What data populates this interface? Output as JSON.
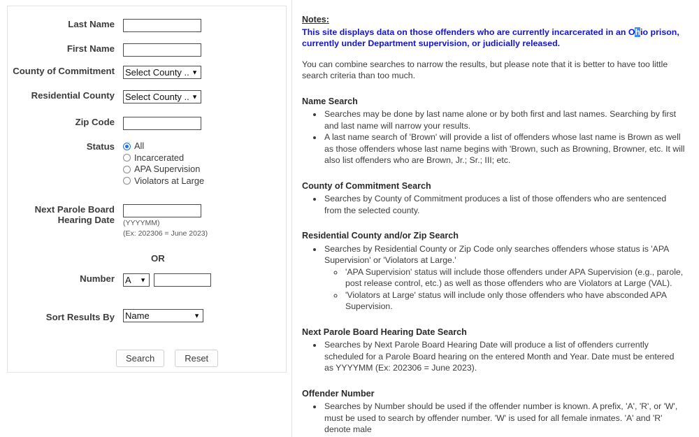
{
  "form": {
    "fields": {
      "last_name_label": "Last Name",
      "last_name_value": "",
      "first_name_label": "First Name",
      "first_name_value": "",
      "county_commitment_label": "County of Commitment",
      "county_commitment_value": "Select County ...",
      "residential_county_label": "Residential County",
      "residential_county_value": "Select County ...",
      "zip_label": "Zip Code",
      "zip_value": "",
      "status_label": "Status",
      "parole_date_label_line1": "Next Parole Board",
      "parole_date_label_line2": "Hearing Date",
      "parole_date_value": "",
      "parole_hint_format": "(YYYYMM)",
      "parole_hint_example": "(Ex: 202306 = June 2023)",
      "or_text": "OR",
      "number_label": "Number",
      "number_prefix_value": "A",
      "number_value": "",
      "sort_label": "Sort Results By",
      "sort_value": "Name"
    },
    "status_options": [
      {
        "label": "All",
        "selected": true
      },
      {
        "label": "Incarcerated",
        "selected": false
      },
      {
        "label": "APA Supervision",
        "selected": false
      },
      {
        "label": "Violators at Large",
        "selected": false
      }
    ],
    "buttons": {
      "search": "Search",
      "reset": "Reset"
    }
  },
  "notes": {
    "title": "Notes:",
    "highlight_line_a": "This site displays data on those offenders who are currently incarcerated in an O",
    "highlight_selected_char": "h",
    "highlight_line_b": "io prison, currently under Department supervision, or judicially released.",
    "intro_paragraph": "You can combine searches to narrow the results, but please note that it is better to have too little search criteria than too much.",
    "selection_color": "#3a8ef6",
    "blue_text_color": "#1414d2",
    "sections": [
      {
        "heading": "Name Search",
        "bullets": [
          "Searches may be done by last name alone or by both first and last names. Searching by first and last name will narrow your results.",
          "A last name search of 'Brown' will provide a list of offenders whose last name is Brown as well as those offenders whose last name begins with 'Brown, such as Browning, Browner, etc. It will also list offenders who are Brown, Jr.; Sr.; III; etc."
        ]
      },
      {
        "heading": "County of Commitment Search",
        "bullets": [
          "Searches by County of Commitment produces a list of those offenders who are sentenced from the selected county."
        ]
      },
      {
        "heading": "Residential County and/or Zip Search",
        "bullets": [
          "Searches by Residential County or Zip Code only searches offenders whose status is 'APA Supervision' or 'Violators at Large.'"
        ],
        "subbullets": [
          "'APA Supervision' status will include those offenders under APA Supervision (e.g., parole, post release control, etc.) as well as those offenders who are Violators at Large (VAL).",
          "'Violators at Large' status will include only those offenders who have absconded APA Supervision."
        ]
      },
      {
        "heading": "Next Parole Board Hearing Date Search",
        "bullets": [
          "Searches by Next Parole Board Hearing Date will produce a list of offenders currently scheduled for a Parole Board hearing on the entered Month and Year. Date must be entered as YYYYMM (Ex: 202306 = June 2023)."
        ]
      },
      {
        "heading": "Offender Number",
        "bullets": [
          "Searches by Number should be used if the offender number is known. A prefix, 'A', 'R', or 'W', must be used to search by offender number. 'W' is used for all female inmates. 'A' and 'R' denote male"
        ]
      }
    ]
  }
}
